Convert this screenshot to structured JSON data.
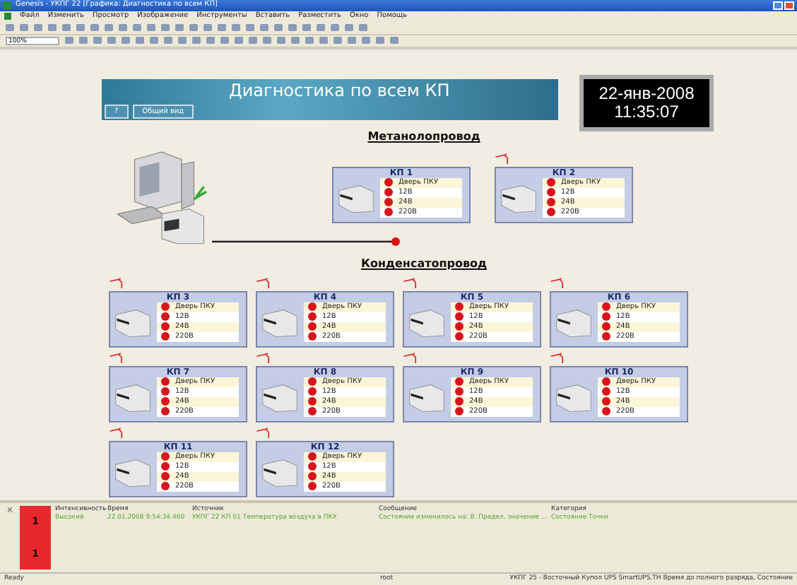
{
  "window": {
    "title": "Genesis - УКПГ 22 [Графика: Диагностика по всем КП]"
  },
  "menu": [
    "Файл",
    "Изменить",
    "Просмотр",
    "Изображение",
    "Инструменты",
    "Вставить",
    "Разместить",
    "Окно",
    "Помощь"
  ],
  "zoom": "100%",
  "banner": {
    "title": "Диагностика по всем КП",
    "buttons": [
      "?",
      "Общий вид"
    ]
  },
  "clock": {
    "date": "22-янв-2008",
    "time": "11:35:07"
  },
  "sections": [
    {
      "title": "Метанолопровод",
      "kind": "link",
      "kps": [
        {
          "name": "КП 1",
          "antenna": false,
          "signals": [
            {
              "label": "Дверь ПКУ",
              "alarm": true
            },
            {
              "label": "12В",
              "alarm": true
            },
            {
              "label": "24В",
              "alarm": true
            },
            {
              "label": "220В",
              "alarm": true
            }
          ]
        },
        {
          "name": "КП 2",
          "antenna": true,
          "signals": [
            {
              "label": "Дверь ПКУ",
              "alarm": true
            },
            {
              "label": "12В",
              "alarm": true
            },
            {
              "label": "24В",
              "alarm": true
            },
            {
              "label": "220В",
              "alarm": true
            }
          ]
        }
      ]
    },
    {
      "title": "Конденсатопровод",
      "kind": "grid",
      "kps": [
        {
          "name": "КП 3",
          "antenna": true,
          "signals": [
            {
              "label": "Дверь ПКУ",
              "alarm": true
            },
            {
              "label": "12В",
              "alarm": true
            },
            {
              "label": "24В",
              "alarm": true
            },
            {
              "label": "220В",
              "alarm": true
            }
          ]
        },
        {
          "name": "КП 4",
          "antenna": true,
          "signals": [
            {
              "label": "Дверь ПКУ",
              "alarm": true
            },
            {
              "label": "12В",
              "alarm": true
            },
            {
              "label": "24В",
              "alarm": true
            },
            {
              "label": "220В",
              "alarm": true
            }
          ]
        },
        {
          "name": "КП 5",
          "antenna": true,
          "signals": [
            {
              "label": "Дверь ПКУ",
              "alarm": true
            },
            {
              "label": "12В",
              "alarm": true
            },
            {
              "label": "24В",
              "alarm": true
            },
            {
              "label": "220В",
              "alarm": true
            }
          ]
        },
        {
          "name": "КП 6",
          "antenna": true,
          "signals": [
            {
              "label": "Дверь ПКУ",
              "alarm": true
            },
            {
              "label": "12В",
              "alarm": true
            },
            {
              "label": "24В",
              "alarm": true
            },
            {
              "label": "220В",
              "alarm": true
            }
          ]
        },
        {
          "name": "КП 7",
          "antenna": true,
          "signals": [
            {
              "label": "Дверь ПКУ",
              "alarm": true
            },
            {
              "label": "12В",
              "alarm": true
            },
            {
              "label": "24В",
              "alarm": true
            },
            {
              "label": "220В",
              "alarm": true
            }
          ]
        },
        {
          "name": "КП 8",
          "antenna": true,
          "signals": [
            {
              "label": "Дверь ПКУ",
              "alarm": true
            },
            {
              "label": "12В",
              "alarm": true
            },
            {
              "label": "24В",
              "alarm": true
            },
            {
              "label": "220В",
              "alarm": true
            }
          ]
        },
        {
          "name": "КП 9",
          "antenna": true,
          "signals": [
            {
              "label": "Дверь ПКУ",
              "alarm": true
            },
            {
              "label": "12В",
              "alarm": true
            },
            {
              "label": "24В",
              "alarm": true
            },
            {
              "label": "220В",
              "alarm": true
            }
          ]
        },
        {
          "name": "КП 10",
          "antenna": true,
          "signals": [
            {
              "label": "Дверь ПКУ",
              "alarm": true
            },
            {
              "label": "12В",
              "alarm": true
            },
            {
              "label": "24В",
              "alarm": true
            },
            {
              "label": "220В",
              "alarm": true
            }
          ]
        },
        {
          "name": "КП 11",
          "antenna": true,
          "signals": [
            {
              "label": "Дверь ПКУ",
              "alarm": true
            },
            {
              "label": "12В",
              "alarm": true
            },
            {
              "label": "24В",
              "alarm": true
            },
            {
              "label": "220В",
              "alarm": true
            }
          ]
        },
        {
          "name": "КП 12",
          "antenna": true,
          "signals": [
            {
              "label": "Дверь ПКУ",
              "alarm": true
            },
            {
              "label": "12В",
              "alarm": true
            },
            {
              "label": "24В",
              "alarm": true
            },
            {
              "label": "220В",
              "alarm": true
            }
          ]
        }
      ]
    }
  ],
  "alarms": {
    "counters": [
      "1",
      "1"
    ],
    "columns": [
      "Интенсивность",
      "Время",
      "Источник",
      "Сообщение",
      "Категория"
    ],
    "rows": [
      [
        "Высокий",
        "22.01.2008 9:54:34.460",
        "УКПГ 22 КП 01 Температура воздуха в ПКУ",
        "Состояние изменилось на: В. Предел, значение ...",
        "Состояние Точки"
      ]
    ]
  },
  "status_bar": [
    "Ready",
    "root",
    "УКПГ 25 - Восточный Купол UPS SmartUPS.TH Время до полного разряда, Состояние"
  ]
}
